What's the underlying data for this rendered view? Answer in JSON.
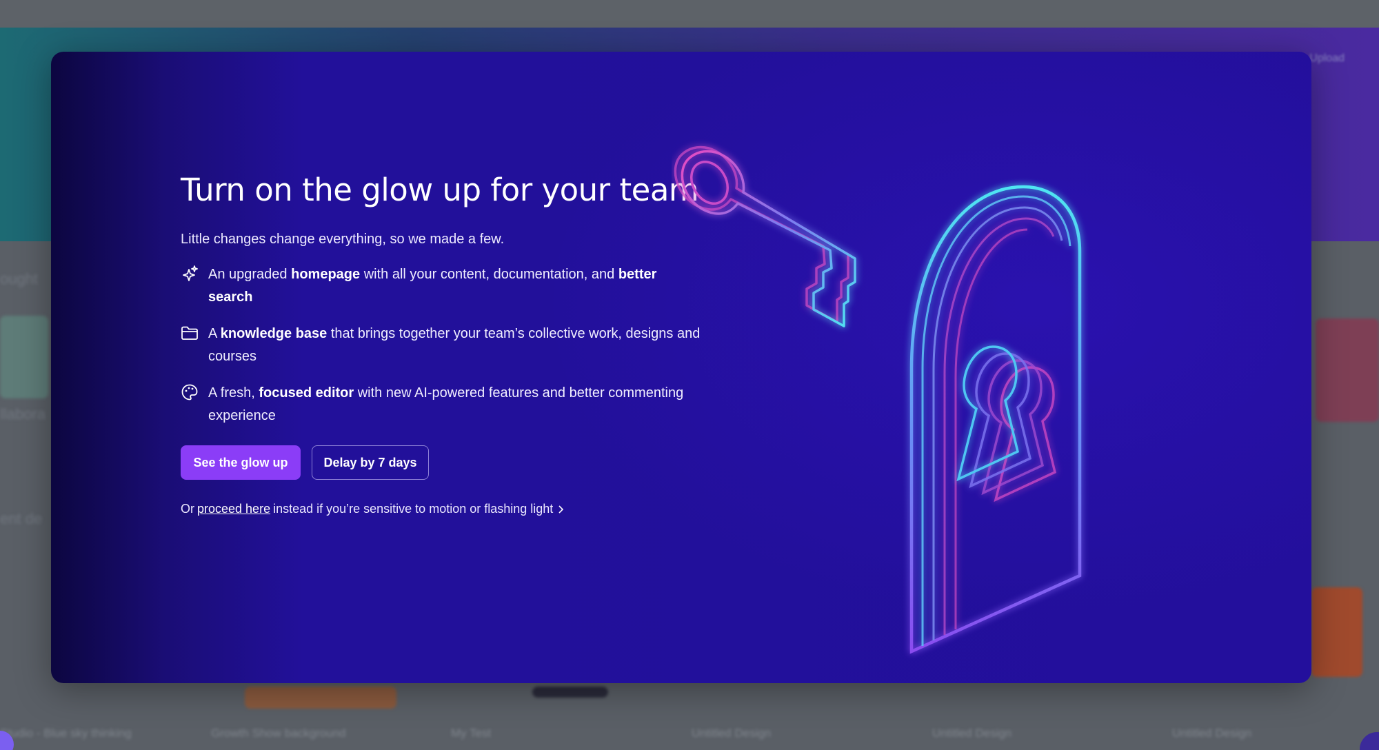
{
  "background": {
    "hero_right_label": "Upload",
    "captions": [
      "Studio - Blue sky thinking",
      "Growth Show background",
      "My Test",
      "Untitled Design",
      "Untitled Design",
      "Untitled Design"
    ]
  },
  "modal": {
    "headline": "Turn on the glow up for your team",
    "subtitle": "Little changes change everything, so we made a few.",
    "features": [
      {
        "icon": "sparkle-icon",
        "pre": "An upgraded ",
        "bold1": "homepage",
        "mid": " with all your content, documentation, and ",
        "bold2": "better search",
        "post": ""
      },
      {
        "icon": "folder-icon",
        "pre": "A ",
        "bold1": "knowledge base",
        "mid": " that brings together your team’s collective work, designs and courses",
        "bold2": "",
        "post": ""
      },
      {
        "icon": "palette-icon",
        "pre": "A fresh, ",
        "bold1": "focused editor",
        "mid": " with new AI-powered features and better commenting experience",
        "bold2": "",
        "post": ""
      }
    ],
    "primary_button": "See the glow up",
    "secondary_button": "Delay by 7 days",
    "footnote": {
      "prefix": "Or",
      "link": "proceed here",
      "suffix": "instead if you’re sensitive to motion or flashing light"
    },
    "illustration": "key-and-keyhole-door-illustration"
  },
  "colors": {
    "primary": "#8b3df7",
    "modal_bg": "#230f9c",
    "glow_cyan": "#4fe6f2",
    "glow_pink": "#e84ac2"
  }
}
